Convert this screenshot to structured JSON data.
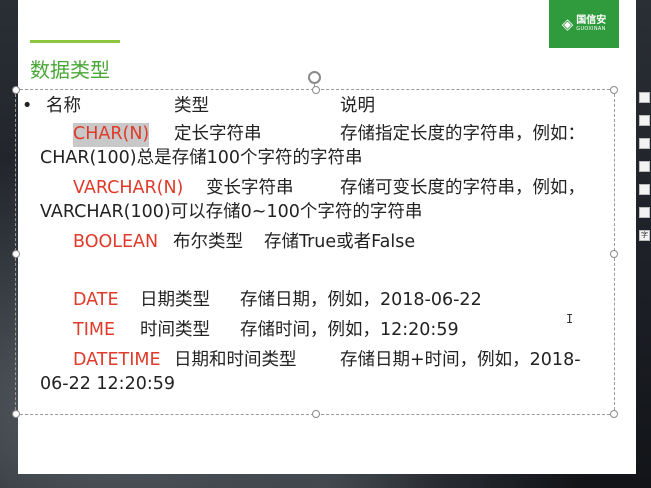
{
  "slide": {
    "title": "数据类型",
    "logo": {
      "cn": "国信安",
      "en": "GUOXINAN",
      "mark": "◈"
    }
  },
  "header_row": {
    "bullet": "•",
    "name": "名称",
    "type": "类型",
    "desc": "说明"
  },
  "rows": [
    {
      "name": "CHAR(N)",
      "type": "定长字符串",
      "desc": "存储指定长度的字符串，例如：",
      "cont": "CHAR(100)总是存储100个字符的字符串"
    },
    {
      "name": "VARCHAR(N)",
      "type": "变长字符串",
      "desc": "存储可变长度的字符串，例如，",
      "cont": "VARCHAR(100)可以存储0~100个字符的字符串"
    },
    {
      "name": "BOOLEAN",
      "type": "布尔类型",
      "desc": "存储True或者False"
    },
    {
      "name": "DATE",
      "type": "日期类型",
      "desc": "存储日期，例如，2018-06-22"
    },
    {
      "name": "TIME",
      "type": "时间类型",
      "desc": "存储时间，例如，12:20:59"
    },
    {
      "name": "DATETIME",
      "type": "日期和时间类型",
      "desc": "存储日期+时间，例如，2018-",
      "cont": "06-22 12:20:59"
    }
  ],
  "right_tools": [
    "",
    "",
    "",
    "",
    "",
    "",
    "字"
  ],
  "cursor": "I",
  "colors": {
    "accent_green": "#4aa637",
    "keyword_red": "#e03a2a",
    "logo_bg": "#2f9b3c"
  }
}
